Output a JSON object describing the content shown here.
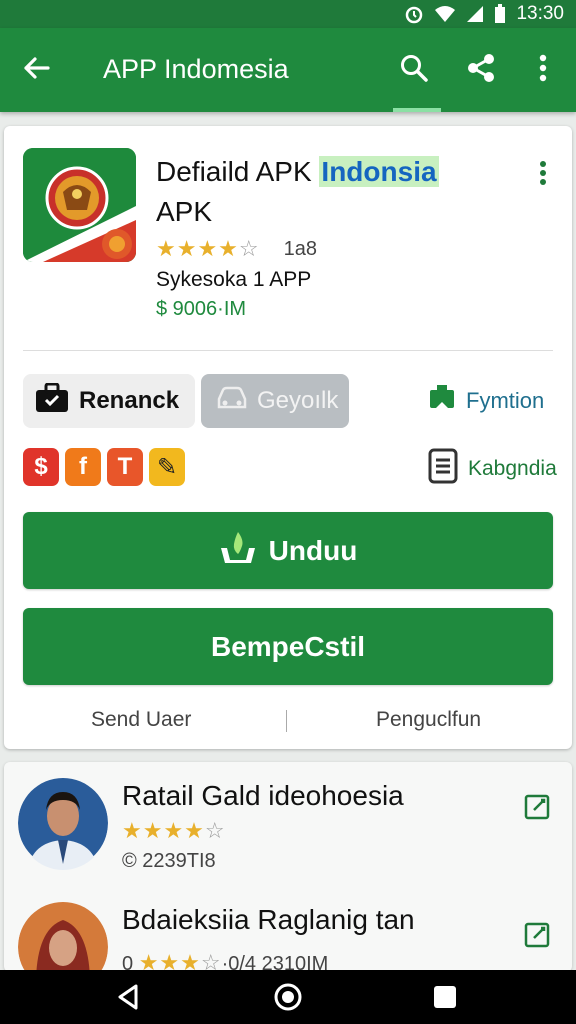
{
  "status_bar": {
    "time": "13:30"
  },
  "app_bar": {
    "title": "APP Indomesia"
  },
  "app": {
    "name_main": "Defiaild APK ",
    "name_highlight": "Indonsia",
    "name_line2": "APK",
    "rating_stars": 4,
    "rating_max": 5,
    "rating_count": "1a8",
    "developer": "Sykesoka 1 APP",
    "price": "$ 9006·IM"
  },
  "chips": {
    "first_label": "Renanck",
    "second_label": "Geyoılk",
    "third_label": "Fymtion"
  },
  "share_icons": [
    "$",
    "f",
    "T",
    "✎"
  ],
  "category_label": "Kabgndia",
  "buttons": {
    "download_label": "Unduu",
    "second_label": "BempeCstil"
  },
  "footer_links": {
    "left": "Send Uaer",
    "right": "Penguclfun"
  },
  "reviews": [
    {
      "name": "Ratail Gald ideohoesia",
      "stars": 4,
      "meta": "© 2239TI8"
    },
    {
      "name": "Bdaieksiia Raglanig tan",
      "stars": 3,
      "meta_prefix": "0",
      "meta": "·0/4 2310IM"
    }
  ],
  "colors": {
    "primary": "#1f8a3e",
    "status_bar": "#1f7a3a",
    "accent_link": "#1565c0",
    "star": "#e8b02c"
  }
}
